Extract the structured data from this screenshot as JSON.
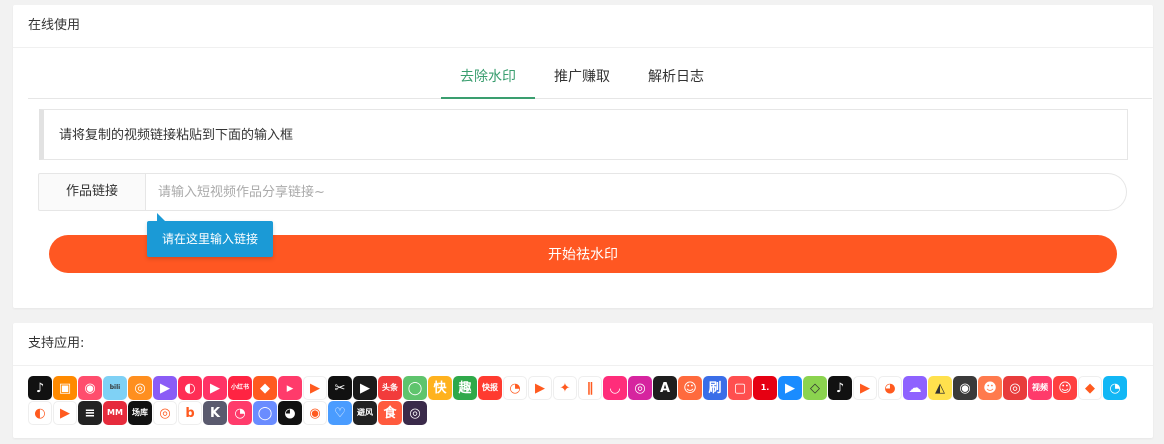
{
  "online": {
    "header": "在线使用",
    "tabs": [
      {
        "label": "去除水印",
        "active": true
      },
      {
        "label": "推广赚取",
        "active": false
      },
      {
        "label": "解析日志",
        "active": false
      }
    ],
    "tip": "请将复制的视频链接粘贴到下面的输入框",
    "input_label": "作品链接",
    "input_placeholder": "请输入短视频作品分享链接~",
    "tooltip": "请在这里输入链接",
    "start_button": "开始祛水印"
  },
  "supported": {
    "header": "支持应用:",
    "apps": [
      {
        "icon": "douyin-icon",
        "glyph": "♪",
        "bg": "#111111"
      },
      {
        "icon": "kuaishou-icon",
        "glyph": "▣",
        "bg": "#ff8a00"
      },
      {
        "icon": "weishi-icon",
        "glyph": "◉",
        "bg": "#ff4d6d"
      },
      {
        "icon": "bilibili-icon",
        "glyph": "bili",
        "bg": "#7fd1f5"
      },
      {
        "icon": "weibo-icon",
        "glyph": "◎",
        "bg": "#ff8f1f"
      },
      {
        "icon": "video-play-icon",
        "glyph": "▶",
        "bg": "#8a5cf6"
      },
      {
        "icon": "meipai-icon",
        "glyph": "◐",
        "bg": "#ff2d55"
      },
      {
        "icon": "pipi-icon",
        "glyph": "▶",
        "bg": "#ff3366"
      },
      {
        "icon": "xiaohongshu-icon",
        "glyph": "小红书",
        "bg": "#ff2442"
      },
      {
        "icon": "huoshan-icon",
        "glyph": "◆",
        "bg": "#ff5a1f"
      },
      {
        "icon": "video-camera-icon",
        "glyph": "▸",
        "bg": "#ff3b6b"
      },
      {
        "icon": "play-triangle-icon",
        "glyph": "▶",
        "bg": "#ffffff"
      },
      {
        "icon": "capcut-icon",
        "glyph": "✂",
        "bg": "#111111"
      },
      {
        "icon": "xigua-icon",
        "glyph": "▶",
        "bg": "#1a1a1a"
      },
      {
        "icon": "toutiao-icon",
        "glyph": "头条",
        "bg": "#f23b3b"
      },
      {
        "icon": "lvzhou-icon",
        "glyph": "◯",
        "bg": "#5fc46d"
      },
      {
        "icon": "kuaikan-icon",
        "glyph": "快",
        "bg": "#ffb21e"
      },
      {
        "icon": "qutoutiao-icon",
        "glyph": "趣",
        "bg": "#2fa94a"
      },
      {
        "icon": "kuaibao-icon",
        "glyph": "快报",
        "bg": "#ff3b30"
      },
      {
        "icon": "chick-icon",
        "glyph": "◔",
        "bg": "#ffffff"
      },
      {
        "icon": "momo-icon",
        "glyph": "▶",
        "bg": "#ffffff"
      },
      {
        "icon": "twitter-icon",
        "glyph": "✦",
        "bg": "#ffffff"
      },
      {
        "icon": "audio-wave-icon",
        "glyph": "∥",
        "bg": "#ffffff"
      },
      {
        "icon": "smile-icon",
        "glyph": "◡",
        "bg": "#ff2d7a"
      },
      {
        "icon": "instagram-icon",
        "glyph": "◎",
        "bg": "#d6249f"
      },
      {
        "icon": "tantan-icon",
        "glyph": "A",
        "bg": "#1e1e1e"
      },
      {
        "icon": "avatar-face-icon",
        "glyph": "☺",
        "bg": "#ff6a3d"
      },
      {
        "icon": "gang-icon",
        "glyph": "刷",
        "bg": "#3a6ee8"
      },
      {
        "icon": "tv-icon",
        "glyph": "▢",
        "bg": "#ff4f4f"
      },
      {
        "icon": "yi-icon",
        "glyph": "1.",
        "bg": "#e60012"
      },
      {
        "icon": "youku-icon",
        "glyph": "▶",
        "bg": "#1a8cff"
      },
      {
        "icon": "iqiyi-icon",
        "glyph": "◇",
        "bg": "#8bd34f"
      },
      {
        "icon": "tiktok-icon",
        "glyph": "♪",
        "bg": "#111111"
      },
      {
        "icon": "youtube-icon",
        "glyph": "▶",
        "bg": "#ffffff"
      },
      {
        "icon": "cartoon-cat-icon",
        "glyph": "◕",
        "bg": "#ffffff"
      },
      {
        "icon": "ghost-icon",
        "glyph": "☁",
        "bg": "#8e62ff"
      },
      {
        "icon": "pear-icon",
        "glyph": "◭",
        "bg": "#ffe14d"
      },
      {
        "icon": "camera-lens-icon",
        "glyph": "◉",
        "bg": "#3a3a3a"
      },
      {
        "icon": "cartoon-face-icon",
        "glyph": "☻",
        "bg": "#ff7a4d"
      },
      {
        "icon": "netease-music-icon",
        "glyph": "◎",
        "bg": "#e83c3c"
      },
      {
        "icon": "video-label-icon",
        "glyph": "视频",
        "bg": "#ff3b6b"
      },
      {
        "icon": "emoji-face-icon",
        "glyph": "☺",
        "bg": "#ff4040"
      },
      {
        "icon": "bird-icon",
        "glyph": "◆",
        "bg": "#ffffff"
      },
      {
        "icon": "qq-icon",
        "glyph": "◔",
        "bg": "#12b7f5"
      },
      {
        "icon": "squirrel-icon",
        "glyph": "◐",
        "bg": "#ffffff"
      },
      {
        "icon": "play-gradient-icon",
        "glyph": "▶",
        "bg": "#ffffff"
      },
      {
        "icon": "stripes-icon",
        "glyph": "≡",
        "bg": "#222222"
      },
      {
        "icon": "red-circle-icon",
        "glyph": "MM",
        "bg": "#e62b3c"
      },
      {
        "icon": "changku-icon",
        "glyph": "场库",
        "bg": "#111111"
      },
      {
        "icon": "yellow-ring-icon",
        "glyph": "◎",
        "bg": "#ffffff"
      },
      {
        "icon": "letter-b-icon",
        "glyph": "b",
        "bg": "#ffffff"
      },
      {
        "icon": "letter-k-icon",
        "glyph": "K",
        "bg": "#5a5a6e"
      },
      {
        "icon": "search-face-icon",
        "glyph": "◔",
        "bg": "#ff3b6b"
      },
      {
        "icon": "gradient-circle-icon",
        "glyph": "◯",
        "bg": "#6a8cff"
      },
      {
        "icon": "surprised-face-icon",
        "glyph": "◕",
        "bg": "#111111"
      },
      {
        "icon": "monkey-icon",
        "glyph": "◉",
        "bg": "#ffffff"
      },
      {
        "icon": "heart-wave-icon",
        "glyph": "♡",
        "bg": "#4a9cff"
      },
      {
        "icon": "bikaifeng-icon",
        "glyph": "避风",
        "bg": "#222222"
      },
      {
        "icon": "shi-icon",
        "glyph": "食",
        "bg": "#ff5a3d"
      },
      {
        "icon": "purple-ring-icon",
        "glyph": "◎",
        "bg": "#3a2a4a"
      }
    ]
  }
}
